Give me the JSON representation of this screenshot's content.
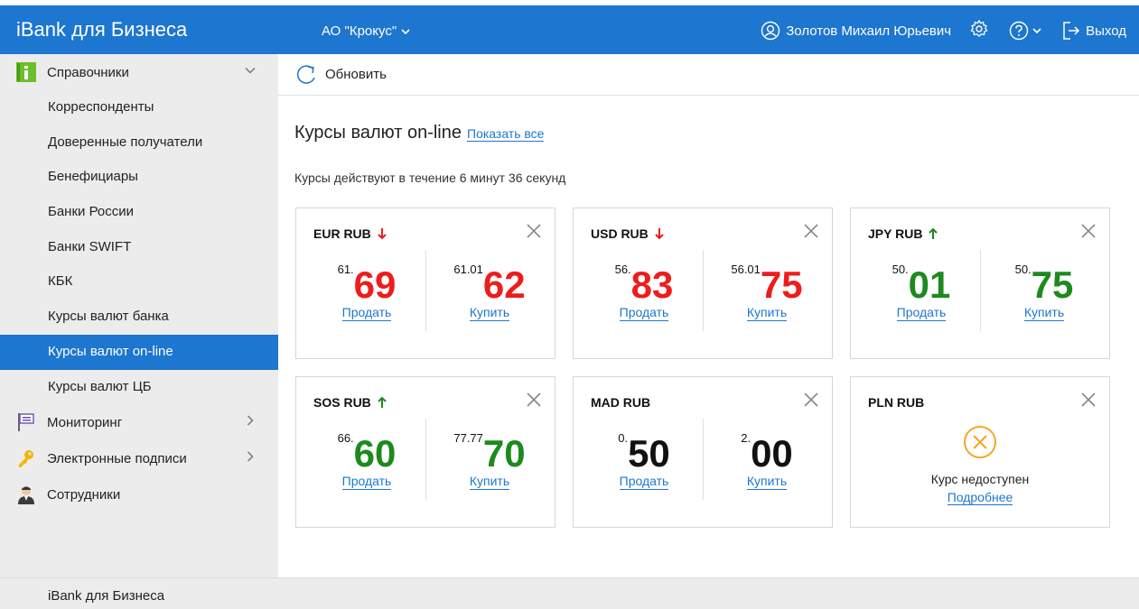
{
  "header": {
    "brand": "iBank для Бизнеса",
    "company": "АО \"Крокус\"",
    "user": "Золотов Михаил Юрьевич",
    "logout": "Выход"
  },
  "sidebar": {
    "groups": [
      {
        "label": "Справочники",
        "icon": "info-icon",
        "expanded": true
      },
      {
        "label": "Мониторинг",
        "icon": "flag-icon"
      },
      {
        "label": "Электронные подписи",
        "icon": "key-icon"
      },
      {
        "label": "Сотрудники",
        "icon": "person-icon"
      }
    ],
    "items": [
      {
        "label": "Корреспонденты"
      },
      {
        "label": "Доверенные получатели"
      },
      {
        "label": "Бенефициары"
      },
      {
        "label": "Банки России"
      },
      {
        "label": "Банки SWIFT"
      },
      {
        "label": "КБК"
      },
      {
        "label": "Курсы валют банка"
      },
      {
        "label": "Курсы валют on-line",
        "active": true
      },
      {
        "label": "Курсы валют ЦБ"
      }
    ]
  },
  "toolbar": {
    "refresh_label": "Обновить"
  },
  "main": {
    "title": "Курсы валют on-line",
    "show_all": "Показать все",
    "validity": "Курсы действуют в течение 6 минут 36 секунд"
  },
  "cards": [
    {
      "pair": "EUR RUB",
      "trend": "down",
      "sell_small": "61.",
      "sell_big": "69",
      "buy_small": "61.01",
      "buy_big": "62",
      "color": "red",
      "sell_label": "Продать",
      "buy_label": "Купить"
    },
    {
      "pair": "USD RUB",
      "trend": "down",
      "sell_small": "56.",
      "sell_big": "83",
      "buy_small": "56.01",
      "buy_big": "75",
      "color": "red",
      "sell_label": "Продать",
      "buy_label": "Купить"
    },
    {
      "pair": "JPY RUB",
      "trend": "up",
      "sell_small": "50.",
      "sell_big": "01",
      "buy_small": "50.",
      "buy_big": "75",
      "color": "green",
      "sell_label": "Продать",
      "buy_label": "Купить"
    },
    {
      "pair": "SOS RUB",
      "trend": "up",
      "sell_small": "66.",
      "sell_big": "60",
      "buy_small": "77.77",
      "buy_big": "70",
      "color": "green",
      "sell_label": "Продать",
      "buy_label": "Купить"
    },
    {
      "pair": "MAD RUB",
      "trend": "none",
      "sell_small": "0.",
      "sell_big": "50",
      "buy_small": "2.",
      "buy_big": "00",
      "color": "black",
      "sell_label": "Продать",
      "buy_label": "Купить"
    },
    {
      "pair": "PLN RUB",
      "unavailable": true,
      "na_text": "Курс недоступен",
      "more": "Подробнее"
    }
  ],
  "footer": {
    "text": "iBank для Бизнеса"
  },
  "colors": {
    "accent": "#1d76cf",
    "down": "#ee1c1c",
    "up": "#1d8a1d",
    "warning": "#f5a623"
  }
}
